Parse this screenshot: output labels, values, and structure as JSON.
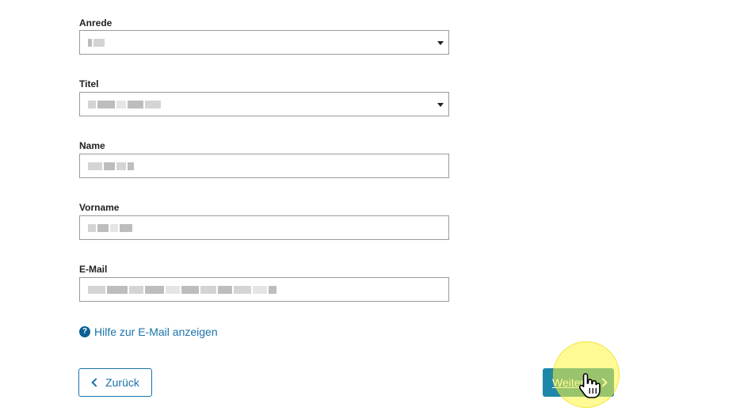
{
  "fields": [
    {
      "label": "Anrede",
      "type": "select"
    },
    {
      "label": "Titel",
      "type": "select"
    },
    {
      "label": "Name",
      "type": "text"
    },
    {
      "label": "Vorname",
      "type": "text"
    },
    {
      "label": "E-Mail",
      "type": "text"
    }
  ],
  "help_link": "Hilfe zur E-Mail anzeigen",
  "help_icon_glyph": "?",
  "back_button": "Zurück",
  "next_button": "Weiter",
  "colors": {
    "link": "#1a73a8",
    "primary_button": "#1e87a8",
    "help_icon": "#0a5f93",
    "cursor_highlight": "#fff53c"
  },
  "icons": {
    "help": "question-circle-icon",
    "back": "chevron-left-icon",
    "next": "chevron-right-icon",
    "dropdown": "caret-down-icon",
    "cursor": "hand-pointer-cursor"
  }
}
